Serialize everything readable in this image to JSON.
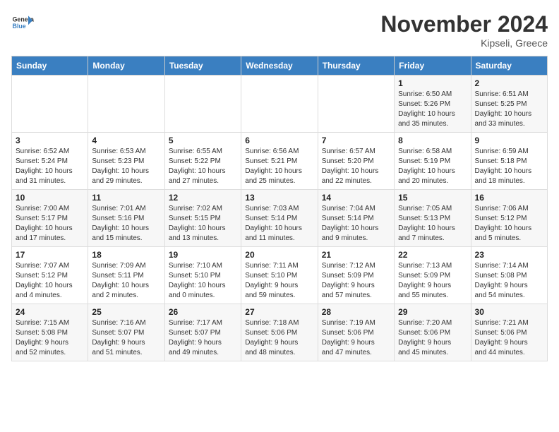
{
  "header": {
    "logo_line1": "General",
    "logo_line2": "Blue",
    "month": "November 2024",
    "location": "Kipseli, Greece"
  },
  "weekdays": [
    "Sunday",
    "Monday",
    "Tuesday",
    "Wednesday",
    "Thursday",
    "Friday",
    "Saturday"
  ],
  "weeks": [
    [
      {
        "day": "",
        "info": ""
      },
      {
        "day": "",
        "info": ""
      },
      {
        "day": "",
        "info": ""
      },
      {
        "day": "",
        "info": ""
      },
      {
        "day": "",
        "info": ""
      },
      {
        "day": "1",
        "info": "Sunrise: 6:50 AM\nSunset: 5:26 PM\nDaylight: 10 hours\nand 35 minutes."
      },
      {
        "day": "2",
        "info": "Sunrise: 6:51 AM\nSunset: 5:25 PM\nDaylight: 10 hours\nand 33 minutes."
      }
    ],
    [
      {
        "day": "3",
        "info": "Sunrise: 6:52 AM\nSunset: 5:24 PM\nDaylight: 10 hours\nand 31 minutes."
      },
      {
        "day": "4",
        "info": "Sunrise: 6:53 AM\nSunset: 5:23 PM\nDaylight: 10 hours\nand 29 minutes."
      },
      {
        "day": "5",
        "info": "Sunrise: 6:55 AM\nSunset: 5:22 PM\nDaylight: 10 hours\nand 27 minutes."
      },
      {
        "day": "6",
        "info": "Sunrise: 6:56 AM\nSunset: 5:21 PM\nDaylight: 10 hours\nand 25 minutes."
      },
      {
        "day": "7",
        "info": "Sunrise: 6:57 AM\nSunset: 5:20 PM\nDaylight: 10 hours\nand 22 minutes."
      },
      {
        "day": "8",
        "info": "Sunrise: 6:58 AM\nSunset: 5:19 PM\nDaylight: 10 hours\nand 20 minutes."
      },
      {
        "day": "9",
        "info": "Sunrise: 6:59 AM\nSunset: 5:18 PM\nDaylight: 10 hours\nand 18 minutes."
      }
    ],
    [
      {
        "day": "10",
        "info": "Sunrise: 7:00 AM\nSunset: 5:17 PM\nDaylight: 10 hours\nand 17 minutes."
      },
      {
        "day": "11",
        "info": "Sunrise: 7:01 AM\nSunset: 5:16 PM\nDaylight: 10 hours\nand 15 minutes."
      },
      {
        "day": "12",
        "info": "Sunrise: 7:02 AM\nSunset: 5:15 PM\nDaylight: 10 hours\nand 13 minutes."
      },
      {
        "day": "13",
        "info": "Sunrise: 7:03 AM\nSunset: 5:14 PM\nDaylight: 10 hours\nand 11 minutes."
      },
      {
        "day": "14",
        "info": "Sunrise: 7:04 AM\nSunset: 5:14 PM\nDaylight: 10 hours\nand 9 minutes."
      },
      {
        "day": "15",
        "info": "Sunrise: 7:05 AM\nSunset: 5:13 PM\nDaylight: 10 hours\nand 7 minutes."
      },
      {
        "day": "16",
        "info": "Sunrise: 7:06 AM\nSunset: 5:12 PM\nDaylight: 10 hours\nand 5 minutes."
      }
    ],
    [
      {
        "day": "17",
        "info": "Sunrise: 7:07 AM\nSunset: 5:12 PM\nDaylight: 10 hours\nand 4 minutes."
      },
      {
        "day": "18",
        "info": "Sunrise: 7:09 AM\nSunset: 5:11 PM\nDaylight: 10 hours\nand 2 minutes."
      },
      {
        "day": "19",
        "info": "Sunrise: 7:10 AM\nSunset: 5:10 PM\nDaylight: 10 hours\nand 0 minutes."
      },
      {
        "day": "20",
        "info": "Sunrise: 7:11 AM\nSunset: 5:10 PM\nDaylight: 9 hours\nand 59 minutes."
      },
      {
        "day": "21",
        "info": "Sunrise: 7:12 AM\nSunset: 5:09 PM\nDaylight: 9 hours\nand 57 minutes."
      },
      {
        "day": "22",
        "info": "Sunrise: 7:13 AM\nSunset: 5:09 PM\nDaylight: 9 hours\nand 55 minutes."
      },
      {
        "day": "23",
        "info": "Sunrise: 7:14 AM\nSunset: 5:08 PM\nDaylight: 9 hours\nand 54 minutes."
      }
    ],
    [
      {
        "day": "24",
        "info": "Sunrise: 7:15 AM\nSunset: 5:08 PM\nDaylight: 9 hours\nand 52 minutes."
      },
      {
        "day": "25",
        "info": "Sunrise: 7:16 AM\nSunset: 5:07 PM\nDaylight: 9 hours\nand 51 minutes."
      },
      {
        "day": "26",
        "info": "Sunrise: 7:17 AM\nSunset: 5:07 PM\nDaylight: 9 hours\nand 49 minutes."
      },
      {
        "day": "27",
        "info": "Sunrise: 7:18 AM\nSunset: 5:06 PM\nDaylight: 9 hours\nand 48 minutes."
      },
      {
        "day": "28",
        "info": "Sunrise: 7:19 AM\nSunset: 5:06 PM\nDaylight: 9 hours\nand 47 minutes."
      },
      {
        "day": "29",
        "info": "Sunrise: 7:20 AM\nSunset: 5:06 PM\nDaylight: 9 hours\nand 45 minutes."
      },
      {
        "day": "30",
        "info": "Sunrise: 7:21 AM\nSunset: 5:06 PM\nDaylight: 9 hours\nand 44 minutes."
      }
    ]
  ]
}
